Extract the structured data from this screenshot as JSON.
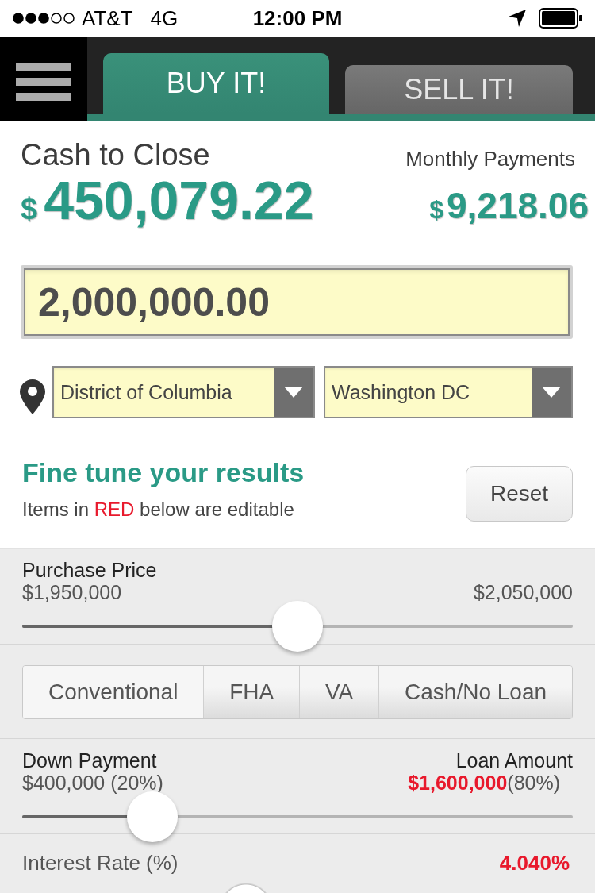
{
  "status_bar": {
    "carrier": "AT&T",
    "network": "4G",
    "time": "12:00 PM"
  },
  "header": {
    "tabs": [
      {
        "label": "BUY IT!",
        "selected": true
      },
      {
        "label": "SELL IT!",
        "selected": false
      }
    ]
  },
  "summary": {
    "cash_to_close": {
      "label": "Cash to Close",
      "currency": "$",
      "amount": "450,079.22"
    },
    "monthly_payments": {
      "label": "Monthly Payments",
      "currency": "$",
      "amount": "9,218.06"
    }
  },
  "price_input": {
    "value": "2,000,000.00"
  },
  "location": {
    "selects": [
      {
        "value": "District of Columbia"
      },
      {
        "value": "Washington DC"
      }
    ]
  },
  "fine_tune": {
    "title": "Fine tune your results",
    "note_before": "Items in",
    "note_highlight": "RED",
    "note_after": "below are editable",
    "reset_button": "Reset"
  },
  "purchase_price": {
    "label": "Purchase Price",
    "min": "$1,950,000",
    "max": "$2,050,000",
    "level": 0.5
  },
  "loan_types": [
    {
      "label": "Conventional",
      "selected": true
    },
    {
      "label": "FHA",
      "selected": false
    },
    {
      "label": "VA",
      "selected": false
    },
    {
      "label": "Cash/No Loan",
      "selected": false
    }
  ],
  "down_payment": {
    "label": "Down Payment",
    "value": "$400,000 (20%)",
    "level": 0.236
  },
  "loan_amount": {
    "label": "Loan Amount",
    "value": "$1,600,000",
    "percent": "(80%)"
  },
  "interest_rate": {
    "label": "Interest Rate (%)",
    "value": "4.040%",
    "level": 0.406
  }
}
